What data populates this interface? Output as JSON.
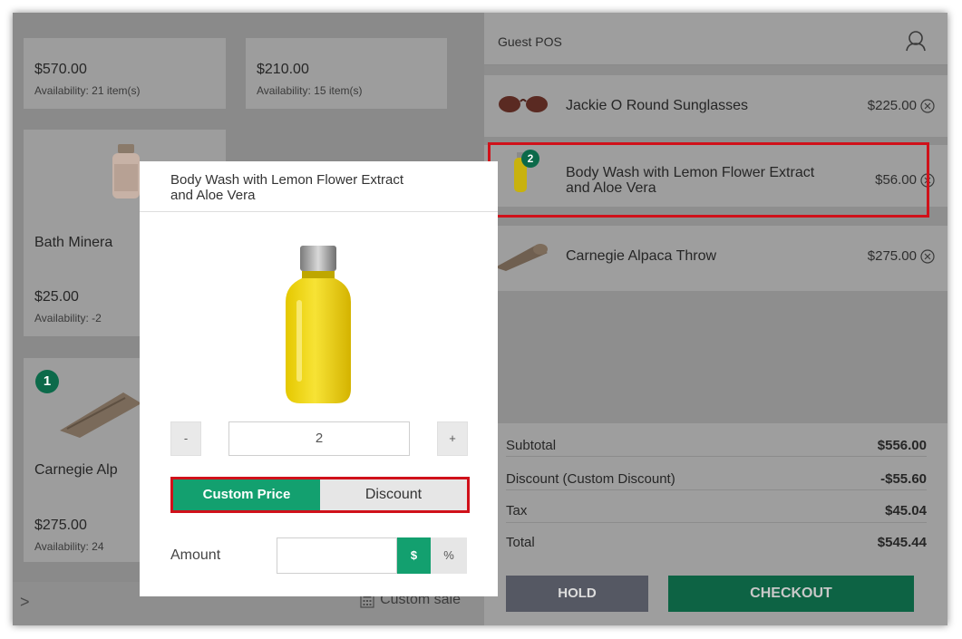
{
  "colors": {
    "accent_green": "#13a06f",
    "dark_green": "#0d6344",
    "highlight_red": "#d0111a"
  },
  "grid": {
    "tiles": [
      {
        "price": "$570.00",
        "availability": "Availability: 21 item(s)"
      },
      {
        "price": "$210.00",
        "availability": "Availability: 15 item(s)"
      },
      {
        "name": "Bath Minera",
        "price": "$25.00",
        "availability": "Availability: -2"
      },
      {
        "badge": "1",
        "name": "Carnegie Alp",
        "price": "$275.00",
        "availability": "Availability: 24"
      }
    ],
    "nav_next": ">",
    "custom_sale": "Custom sale"
  },
  "cart": {
    "title": "Guest POS",
    "user_icon": "user-icon",
    "items": [
      {
        "name": "Jackie O Round Sunglasses",
        "price": "$225.00"
      },
      {
        "badge": "2",
        "name_line1": "Body Wash with Lemon Flower Extract",
        "name_line2": "and Aloe Vera",
        "price": "$56.00"
      },
      {
        "name": "Carnegie Alpaca Throw",
        "price": "$275.00"
      }
    ],
    "totals": [
      {
        "label": "Subtotal",
        "value": "$556.00"
      },
      {
        "label": "Discount (Custom Discount)",
        "value": "-$55.60"
      },
      {
        "label": "Tax",
        "value": "$45.04"
      },
      {
        "label": "Total",
        "value": "$545.44"
      }
    ],
    "hold_label": "HOLD",
    "checkout_label": "CHECKOUT"
  },
  "modal": {
    "title_line1": "Body Wash with Lemon Flower Extract",
    "title_line2": "and Aloe Vera",
    "minus": "-",
    "plus": "+",
    "quantity": "2",
    "custom_price_tab": "Custom Price",
    "discount_tab": "Discount",
    "amount_label": "Amount",
    "amount_value": "",
    "unit_dollar": "$",
    "unit_percent": "%"
  }
}
